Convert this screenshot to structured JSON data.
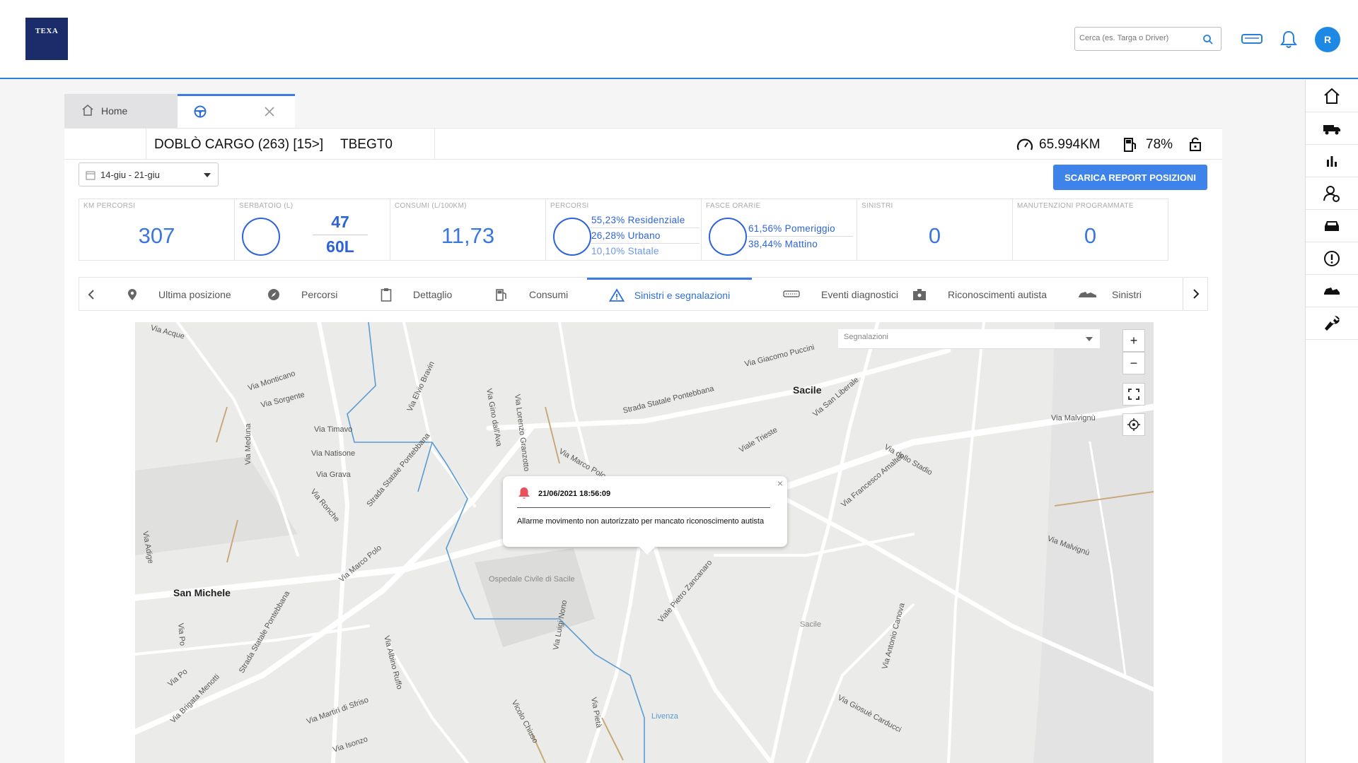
{
  "header": {
    "logo_text": "TEXA",
    "search_placeholder": "Cerca (es. Targa o Driver)",
    "avatar_initial": "R"
  },
  "tabs": [
    {
      "label": "Home"
    },
    {
      "label": ""
    }
  ],
  "vehicle": {
    "name": "DOBLÒ CARGO (263) [15>]",
    "plate": "TBEGT0",
    "odometer": "65.994KM",
    "fuel": "78%"
  },
  "toolbar": {
    "date_range": "14-giu - 21-giu",
    "download_button": "SCARICA REPORT POSIZIONI"
  },
  "stats": {
    "km": {
      "label": "KM PERCORSI",
      "value": "307"
    },
    "tank": {
      "label": "SERBATOIO (L)",
      "value": "47",
      "capacity": "60L"
    },
    "consumption": {
      "label": "CONSUMI (L/100KM)",
      "value": "11,73"
    },
    "routes": {
      "label": "PERCORSI",
      "items": [
        "55,23% Residenziale",
        "26,28% Urbano",
        "10,10% Statale"
      ]
    },
    "time_bands": {
      "label": "FASCE ORARIE",
      "items": [
        "61,56% Pomeriggio",
        "38,44% Mattino"
      ]
    },
    "accidents": {
      "label": "SINISTRI",
      "value": "0"
    },
    "maintenance": {
      "label": "MANUTENZIONI PROGRAMMATE",
      "value": "0"
    }
  },
  "subtabs": [
    {
      "label": "Ultima posizione",
      "icon": "location-pin-icon"
    },
    {
      "label": "Percorsi",
      "icon": "compass-icon"
    },
    {
      "label": "Dettaglio",
      "icon": "clipboard-icon"
    },
    {
      "label": "Consumi",
      "icon": "fuel-pump-icon"
    },
    {
      "label": "Sinistri e segnalazioni",
      "icon": "warning-icon",
      "active": true
    },
    {
      "label": "Eventi diagnostici",
      "icon": "diagnostic-icon"
    },
    {
      "label": "Riconoscimenti autista",
      "icon": "id-badge-icon"
    },
    {
      "label": "Sinistri",
      "icon": "crash-icon"
    }
  ],
  "map": {
    "filter_placeholder": "Segnalazioni",
    "zoom_in": "+",
    "zoom_out": "−",
    "popup": {
      "datetime": "21/06/2021 18:56:09",
      "message": "Allarme movimento non autorizzato per mancato riconoscimento autista"
    },
    "labels": {
      "sacile": "Sacile",
      "san_michele": "San Michele",
      "via_acque": "Via Acque",
      "via_monticano": "Via Monticano",
      "via_sorgente": "Via Sorgente",
      "via_timavo": "Via Timavo",
      "via_natisone": "Via Natisone",
      "via_grava": "Via Grava",
      "via_meduna": "Via Meduna",
      "via_adige": "Via Adige",
      "via_ronche": "Via Ronche",
      "strada_pontebbana": "Strada Statale Pontebbana",
      "via_elvio_bravin": "Via Elvio Bravin",
      "via_gino_dallava": "Via Gino dall'Ava",
      "via_lorenzo_granzotto": "Via Lorenzo Granzotto",
      "via_giacomo_puccini": "Via Giacomo Puccini",
      "via_san_liberale": "Via San Liberale",
      "viale_trieste": "Viale Trieste",
      "via_malvignu": "Via Malvignù",
      "via_dello_stadio": "Via dello Stadio",
      "via_francesco_amalteo": "Via Francesco Amalteo",
      "via_marco_polo": "Via Marco Polo",
      "ospedale": "Ospedale Civile di Sacile",
      "viale_zancanaro": "Viale Pietro Zancanaro",
      "sacile_small": "Sacile",
      "via_antonio_canova": "Via Antonio Canova",
      "via_giosue_carducci": "Via Giosuè Carducci",
      "via_luigi_nono": "Via Luigi Nono",
      "via_albino_ruffo": "Via Albino Ruffo",
      "via_po": "Via Po",
      "via_brigata_menotti": "Via Brigata Menotti",
      "via_martiri": "Via Martiri di Sfriso",
      "via_isonzo": "Via Isonzo",
      "vicolo_chiuso": "Vicolo Chiuso",
      "via_pieta": "Via Pietà",
      "livenza": "Livenza"
    }
  },
  "colors": {
    "accent": "#3d83ea",
    "header_line": "#2a7fd6",
    "logo_bg": "#1b2c6b",
    "avatar": "#1e88e5",
    "alarm": "#e8525a"
  }
}
